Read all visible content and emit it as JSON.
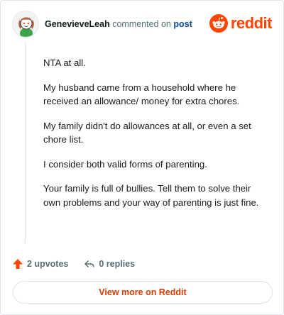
{
  "header": {
    "username": "GenevieveLeah",
    "action_text": "commented on",
    "post_link": "post",
    "brand": "reddit",
    "avatar_icon": "snoo-avatar-icon",
    "brand_icon": "reddit-logo-icon"
  },
  "comment": {
    "paragraphs": [
      "NTA at all.",
      "My husband came from a household where he received an allowance/ money for extra chores.",
      "My family didn't do allowances at all, or even a set chore list.",
      "I consider both valid forms of parenting.",
      "Your family is full of bullies. Tell them to solve their own problems and your way of parenting is just fine."
    ]
  },
  "actions": {
    "upvotes": "2 upvotes",
    "replies": "0 replies",
    "upvote_icon": "upvote-arrow-icon",
    "reply_icon": "reply-icon"
  },
  "footer": {
    "view_more": "View more on Reddit"
  },
  "colors": {
    "brand": "#ff4500",
    "link": "#0a449b",
    "muted": "#576f76",
    "cta": "#d93a00"
  }
}
